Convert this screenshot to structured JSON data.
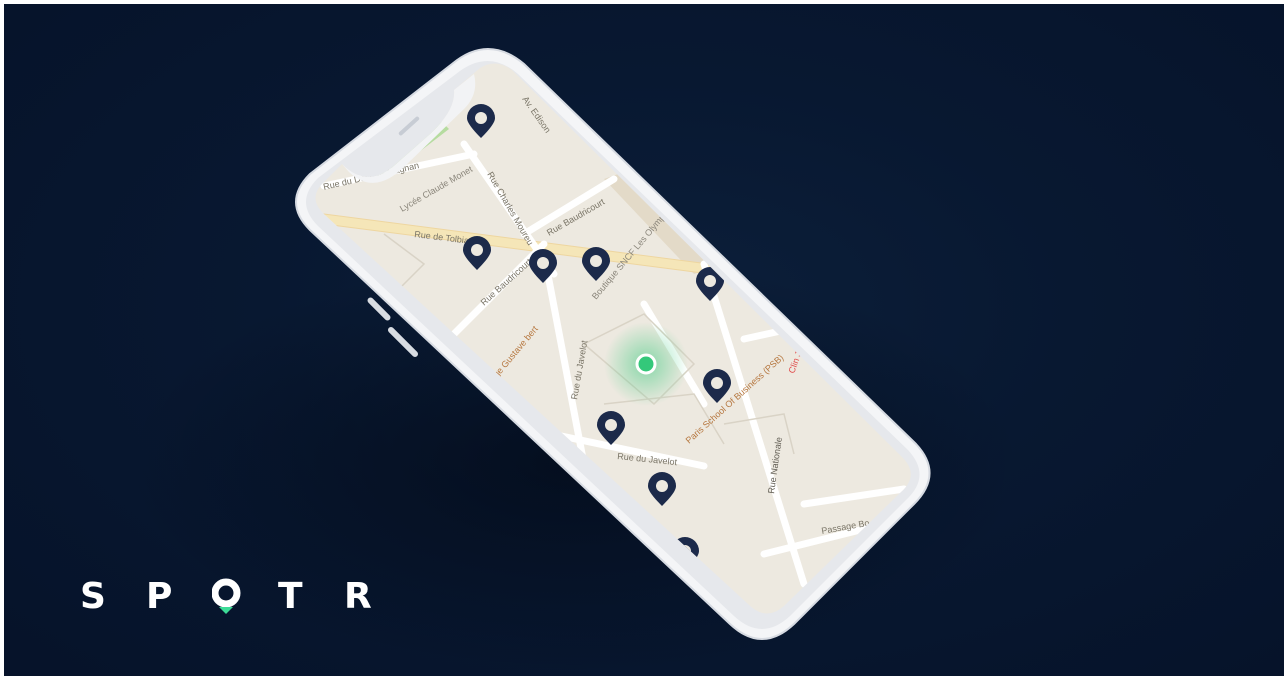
{
  "brand": {
    "letters": [
      "S",
      "P",
      "T",
      "R"
    ],
    "o_mark": "location-pin-o",
    "colors": {
      "text": "#ffffff",
      "accent": "#3ddc97"
    }
  },
  "background": {
    "color": "#081831"
  },
  "map": {
    "street_labels": {
      "magnan": "Rue du Docteur Magnan",
      "tolbiac": "Rue de Tolbiac",
      "baudricourt": "Rue Baudricourt",
      "baudricourt_2": "Rue Baudricourt",
      "monet": "Lycée Claude Monet",
      "sncf": "Boutique SNCF Les Olympiades",
      "gustave": "ège Gustave bert",
      "javelot_v": "Rue du Javelot",
      "javelot_h": "Rue du Javelot",
      "psb": "Paris School Of Business (PSB)",
      "nationale": "Rue Nationale",
      "passage": "Passage Bo",
      "clinic": "Clin Jeann",
      "charles": "Rue Charles Moureu",
      "edison": "Av. Edison"
    },
    "colors": {
      "land": "#ede9e0",
      "road": "#ffffff",
      "park": "#b6dca0",
      "major_road": "#f5e6b8",
      "pin": "#1c2a4a",
      "user_dot": "#34c87a"
    },
    "pins_count_label": ""
  }
}
